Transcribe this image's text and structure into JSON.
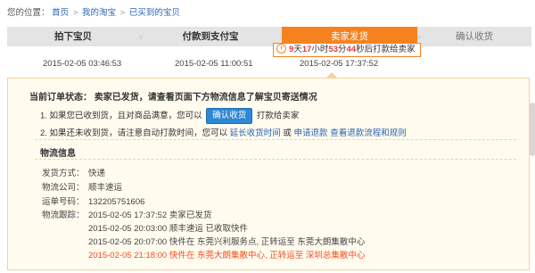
{
  "breadcrumb": {
    "prefix": "您的位置：",
    "items": [
      "首页",
      "我的淘宝",
      "已买到的宝贝"
    ],
    "separator": ">"
  },
  "steps": [
    {
      "label": "拍下宝贝",
      "time": "2015-02-05 03:46:53"
    },
    {
      "label": "付款到支付宝",
      "time": "2015-02-05 11:00:51"
    },
    {
      "label": "卖家发货",
      "time": "2015-02-05 17:37:52"
    },
    {
      "label": "确认收货",
      "time": ""
    }
  ],
  "countdown": {
    "days": "9",
    "days_unit": "天",
    "hours": "17",
    "hours_unit": "小时",
    "minutes": "53",
    "minutes_unit": "分",
    "seconds": "44",
    "seconds_unit": "秒后打款给卖家"
  },
  "order": {
    "status_text": "当前订单状态：  卖家已发货，请查看页面下方物流信息了解宝贝寄送情况",
    "line1_before": "1. 如果您已收到货，且对商品满意，您可以",
    "confirm_button": "确认收货",
    "line1_after": "打款给卖家",
    "line2_before": "2. 如果还未收到货，请注意自动打款时间，您可以",
    "link_extend": "延长收货时间",
    "line2_or": "或",
    "link_refund": "申请退款",
    "link_refund_process": "查看退款流程和规则"
  },
  "logistics": {
    "title": "物流信息",
    "method_label": "发货方式：",
    "method_value": "快递",
    "company_label": "物流公司：",
    "company_value": "顺丰速运",
    "tracking_label": "运单号码：",
    "tracking_value": "132205751606",
    "trace_label": "物流跟踪：",
    "trace": [
      "2015-02-05 17:37:52 卖家已发货",
      "2015-02-05 20:03:00 顺丰速运 已收取快件",
      "2015-02-05 20:07:00 快件在 东莞兴利服务点, 正转运至 东莞大朗集散中心",
      "2015-02-05 21:18:00 快件在 东莞大朗集散中心, 正转运至 深圳总集散中心"
    ]
  },
  "colors": {
    "accent": "#f6821f",
    "link": "#2a63b1",
    "latest_trace": "#f0501e",
    "button": "#2e87d6",
    "panel_bg": "#fffbef"
  }
}
